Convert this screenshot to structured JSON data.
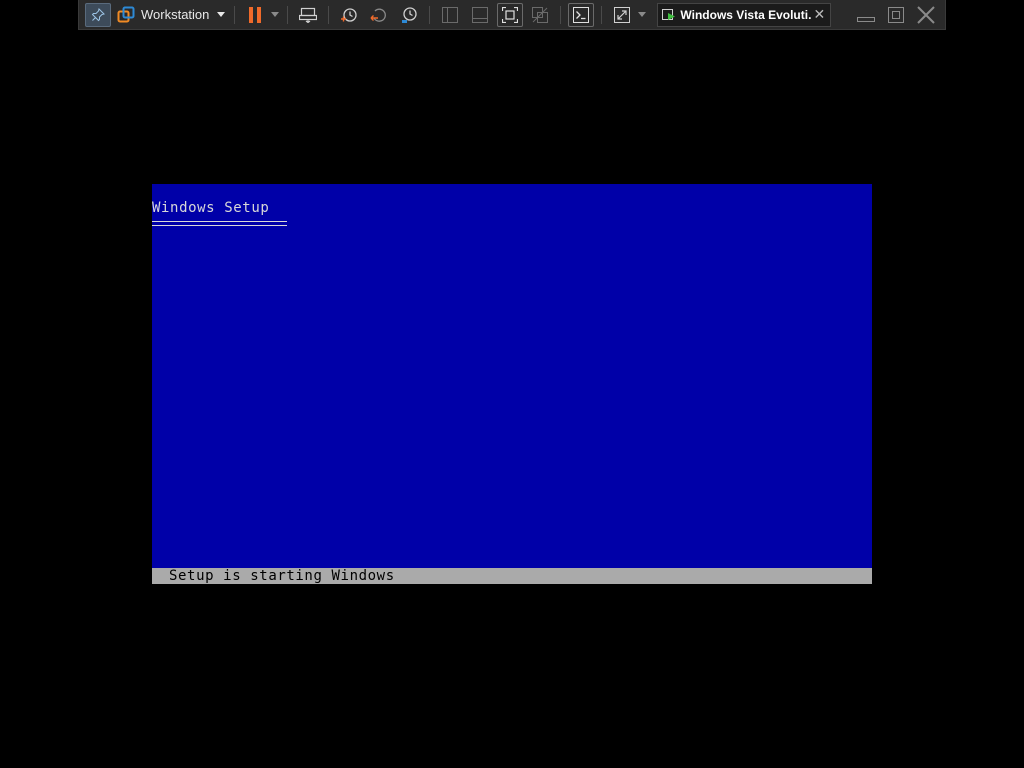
{
  "toolbar": {
    "app_menu_label": "Workstation",
    "vm_tab_title": "Windows Vista Evoluti...",
    "buttons": [
      "pin-icon",
      "vmware-logo-icon",
      "pause-icon",
      "send-ctrl-alt-del-icon",
      "snapshot-icon",
      "revert-snapshot-icon",
      "snapshot-manager-icon",
      "library-icon",
      "thumbnail-bar-icon",
      "full-screen-icon",
      "unity-icon",
      "console-icon",
      "stretch-guest-icon"
    ],
    "colors": {
      "background": "#2a2a2a",
      "pause_accent": "#f06a2a",
      "logo_orange": "#f08a24",
      "logo_blue": "#2d8ad6"
    }
  },
  "guest": {
    "setup_title": "Windows Setup",
    "status_text": "Setup is starting Windows",
    "colors": {
      "screen_background": "#0000a8",
      "status_bar_background": "#aaaaaa"
    }
  }
}
